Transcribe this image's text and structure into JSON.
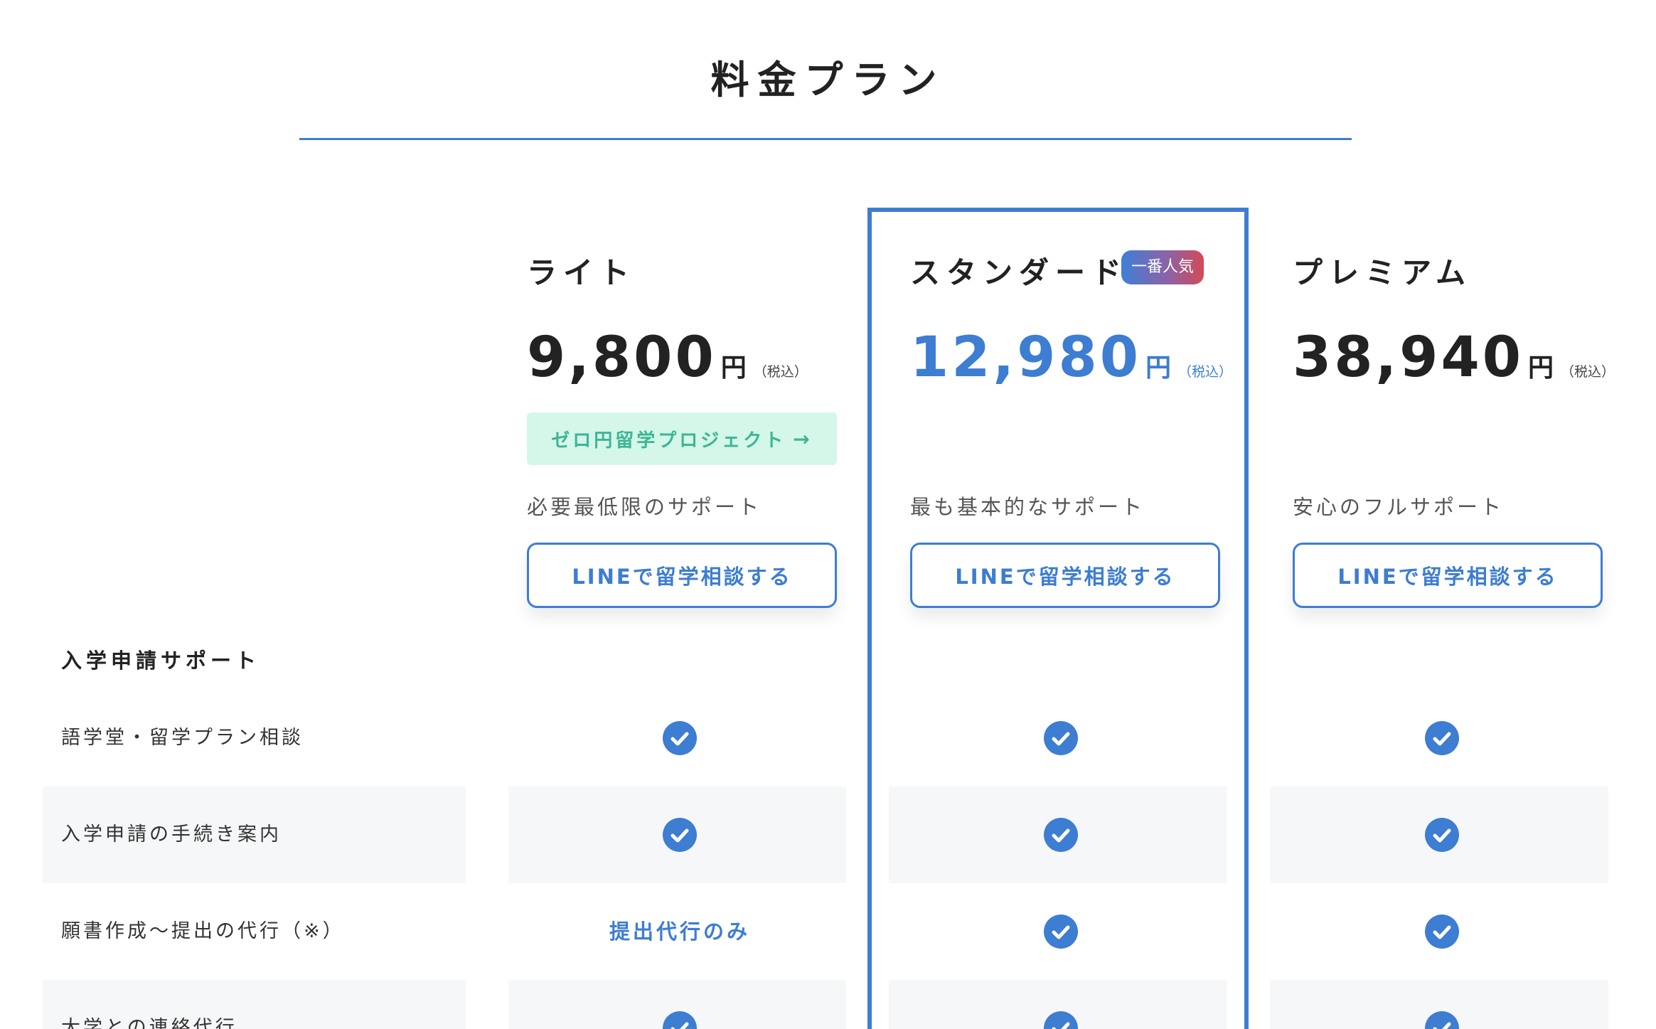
{
  "page": {
    "title": "料金プラン"
  },
  "colors": {
    "accent": "#3d7dd2",
    "project_bg": "#d4f7ea",
    "project_text": "#3db593",
    "row_shade": "#f6f7f9"
  },
  "plans": [
    {
      "name": "ライト",
      "price": "9,800",
      "unit": "円",
      "tax": "（税込）",
      "project_label": "ゼロ円留学プロジェクト",
      "project_arrow": "→",
      "description": "必要最低限のサポート",
      "cta": "LINEで留学相談する"
    },
    {
      "name": "スタンダード",
      "badge": "一番人気",
      "price": "12,980",
      "unit": "円",
      "tax": "（税込）",
      "description": "最も基本的なサポート",
      "cta": "LINEで留学相談する"
    },
    {
      "name": "プレミアム",
      "price": "38,940",
      "unit": "円",
      "tax": "（税込）",
      "description": "安心のフルサポート",
      "cta": "LINEで留学相談する"
    }
  ],
  "features": {
    "section_title": "入学申請サポート",
    "rows": [
      {
        "label": "語学堂・留学プラン相談",
        "values": [
          "check-icon",
          "check-icon",
          "check-icon"
        ]
      },
      {
        "label": "入学申請の手続き案内",
        "values": [
          "check-icon",
          "check-icon",
          "check-icon"
        ]
      },
      {
        "label": "願書作成〜提出の代行（※）",
        "values": [
          "提出代行のみ",
          "check-icon",
          "check-icon"
        ]
      },
      {
        "label": "大学との連絡代行",
        "values": [
          "check-icon",
          "check-icon",
          "check-icon"
        ]
      }
    ]
  }
}
